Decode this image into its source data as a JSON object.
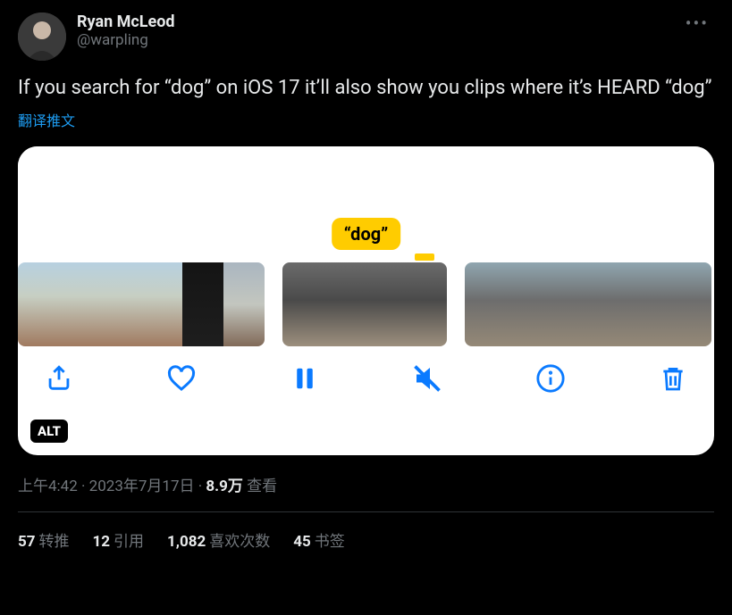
{
  "author": {
    "display_name": "Ryan McLeod",
    "handle": "@warpling"
  },
  "body_text": "If you search for “dog” on iOS 17 it’ll also show you clips where it’s HEARD “dog”",
  "translate_label": "翻译推文",
  "media": {
    "caption_badge": "“dog”",
    "alt_badge": "ALT"
  },
  "meta": {
    "time": "上午4:42",
    "date": "2023年7月17日",
    "views_value": "8.9万",
    "views_label": "查看"
  },
  "stats": {
    "retweets_value": "57",
    "retweets_label": "转推",
    "quotes_value": "12",
    "quotes_label": "引用",
    "likes_value": "1,082",
    "likes_label": "喜欢次数",
    "bookmarks_value": "45",
    "bookmarks_label": "书签"
  }
}
